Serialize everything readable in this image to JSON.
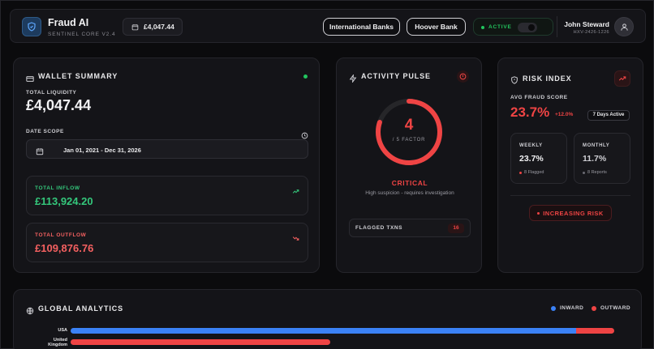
{
  "header": {
    "app_name": "Fraud AI",
    "app_subtitle": "SENTINEL CORE V2.4",
    "balance": "£4,047.44",
    "banks": [
      "International Banks",
      "Hoover Bank"
    ],
    "status": "ACTIVE",
    "user_name": "John Steward",
    "user_id": "HXV-2426-1226"
  },
  "wallet": {
    "title": "WALLET SUMMARY",
    "liquidity_label": "TOTAL LIQUIDITY",
    "liquidity_value": "£4,047.44",
    "date_scope_label": "DATE SCOPE",
    "date_range": "Jan 01, 2021 - Dec 31, 2026",
    "inflow_label": "TOTAL INFLOW",
    "inflow_value": "£113,924.20",
    "outflow_label": "TOTAL OUTFLOW",
    "outflow_value": "£109,876.76"
  },
  "activity": {
    "title": "ACTIVITY PULSE",
    "gauge_value": "4",
    "gauge_max": 5,
    "gauge_fraction": 0.8,
    "gauge_sub": "/ 5 FACTOR",
    "level": "CRITICAL",
    "description": "High suspicion - requires investigation",
    "flagged_label": "FLAGGED TXNS",
    "flagged_count": "16"
  },
  "risk": {
    "title": "RISK INDEX",
    "avg_label": "AVG FRAUD SCORE",
    "avg_value": "23.7%",
    "avg_delta": "+12.0%",
    "days_badge": "7 Days Active",
    "weekly_label": "WEEKLY",
    "weekly_value": "23.7%",
    "weekly_sub": "8 Flagged",
    "monthly_label": "MONTHLY",
    "monthly_value": "11.7%",
    "monthly_sub": "8 Reports",
    "trend": "INCREASING RISK"
  },
  "global": {
    "title": "GLOBAL ANALYTICS",
    "legend_inward": "INWARD",
    "legend_outward": "OUTWARD",
    "countries": [
      {
        "name": "USA",
        "inward": 0.93,
        "outward": 0.07
      },
      {
        "name": "United Kingdom",
        "inward": 0.0,
        "outward": 0.477
      }
    ]
  },
  "colors": {
    "accent_green": "#22c55e",
    "accent_red": "#ef4444",
    "accent_blue": "#3b82f6",
    "background": "#0b0b0d",
    "card": "#141418"
  }
}
